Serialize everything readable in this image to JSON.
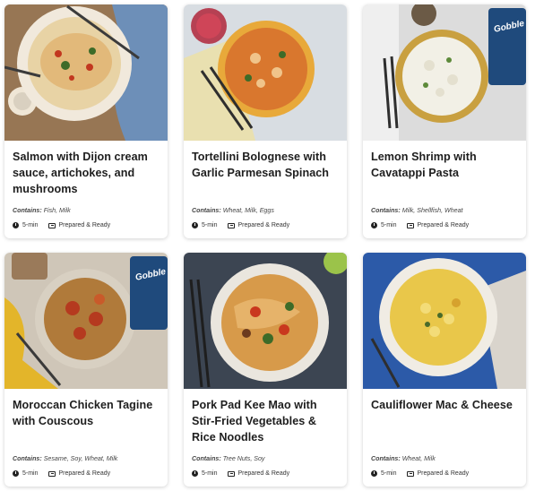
{
  "meals": [
    {
      "title": "Salmon with Dijon cream sauce, artichokes, and mushrooms",
      "contains_label": "Contains:",
      "allergens": "Fish, Milk",
      "time": "5-min",
      "prep": "Prepared & Ready",
      "image": "salmon-dish-photo"
    },
    {
      "title": "Tortellini Bolognese with Garlic Parmesan Spinach",
      "contains_label": "Contains:",
      "allergens": "Wheat, Milk, Eggs",
      "time": "5-min",
      "prep": "Prepared & Ready",
      "image": "tortellini-dish-photo"
    },
    {
      "title": "Lemon Shrimp with Cavatappi Pasta",
      "contains_label": "Contains:",
      "allergens": "Milk, Shellfish, Wheat",
      "time": "5-min",
      "prep": "Prepared & Ready",
      "image": "shrimp-pasta-dish-photo",
      "brand_text": "Gobble"
    },
    {
      "title": "Moroccan Chicken Tagine with Couscous",
      "contains_label": "Contains:",
      "allergens": "Sesame, Soy, Wheat, Milk",
      "time": "5-min",
      "prep": "Prepared & Ready",
      "image": "tagine-dish-photo",
      "brand_text": "Gobble"
    },
    {
      "title": "Pork Pad Kee Mao with Stir-Fried Vegetables & Rice Noodles",
      "contains_label": "Contains:",
      "allergens": "Tree Nuts, Soy",
      "time": "5-min",
      "prep": "Prepared & Ready",
      "image": "pad-kee-mao-dish-photo"
    },
    {
      "title": "Cauliflower Mac & Cheese",
      "contains_label": "Contains:",
      "allergens": "Wheat, Milk",
      "time": "5-min",
      "prep": "Prepared & Ready",
      "image": "mac-cheese-dish-photo"
    }
  ]
}
